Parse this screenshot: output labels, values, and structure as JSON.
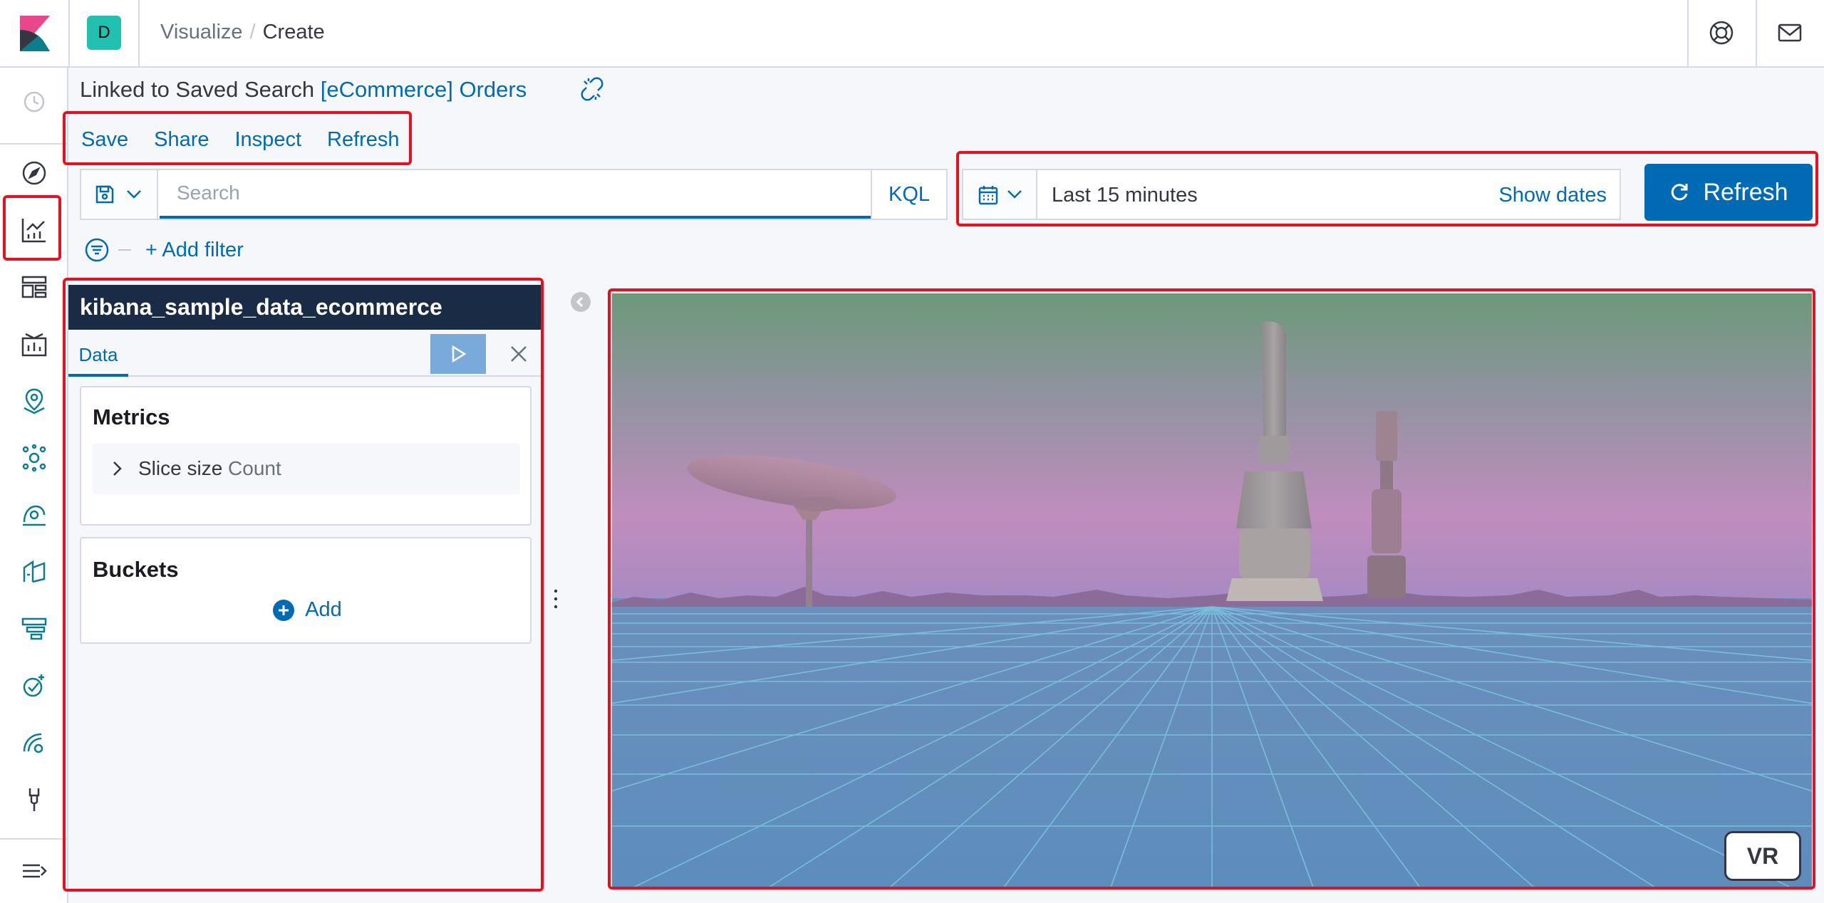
{
  "header": {
    "space_initial": "D",
    "breadcrumbs": [
      "Visualize",
      "Create"
    ],
    "breadcrumb_separator": "/"
  },
  "saved_search": {
    "prefix": "Linked to Saved Search",
    "name": "[eCommerce] Orders"
  },
  "top_nav": [
    "Save",
    "Share",
    "Inspect",
    "Refresh"
  ],
  "query": {
    "placeholder": "Search",
    "language": "KQL"
  },
  "time": {
    "range": "Last 15 minutes",
    "show_dates_label": "Show dates",
    "refresh_label": "Refresh"
  },
  "filter": {
    "add_label": "+ Add filter"
  },
  "editor": {
    "index_pattern": "kibana_sample_data_ecommerce",
    "tab": "Data",
    "metrics_title": "Metrics",
    "metric": {
      "label": "Slice size",
      "value": "Count"
    },
    "buckets_title": "Buckets",
    "add_label": "Add"
  },
  "viz": {
    "vr_label": "VR"
  },
  "colors": {
    "primary": "#006bb4",
    "header_dark": "#1a2b45",
    "highlight": "#e8101e"
  }
}
